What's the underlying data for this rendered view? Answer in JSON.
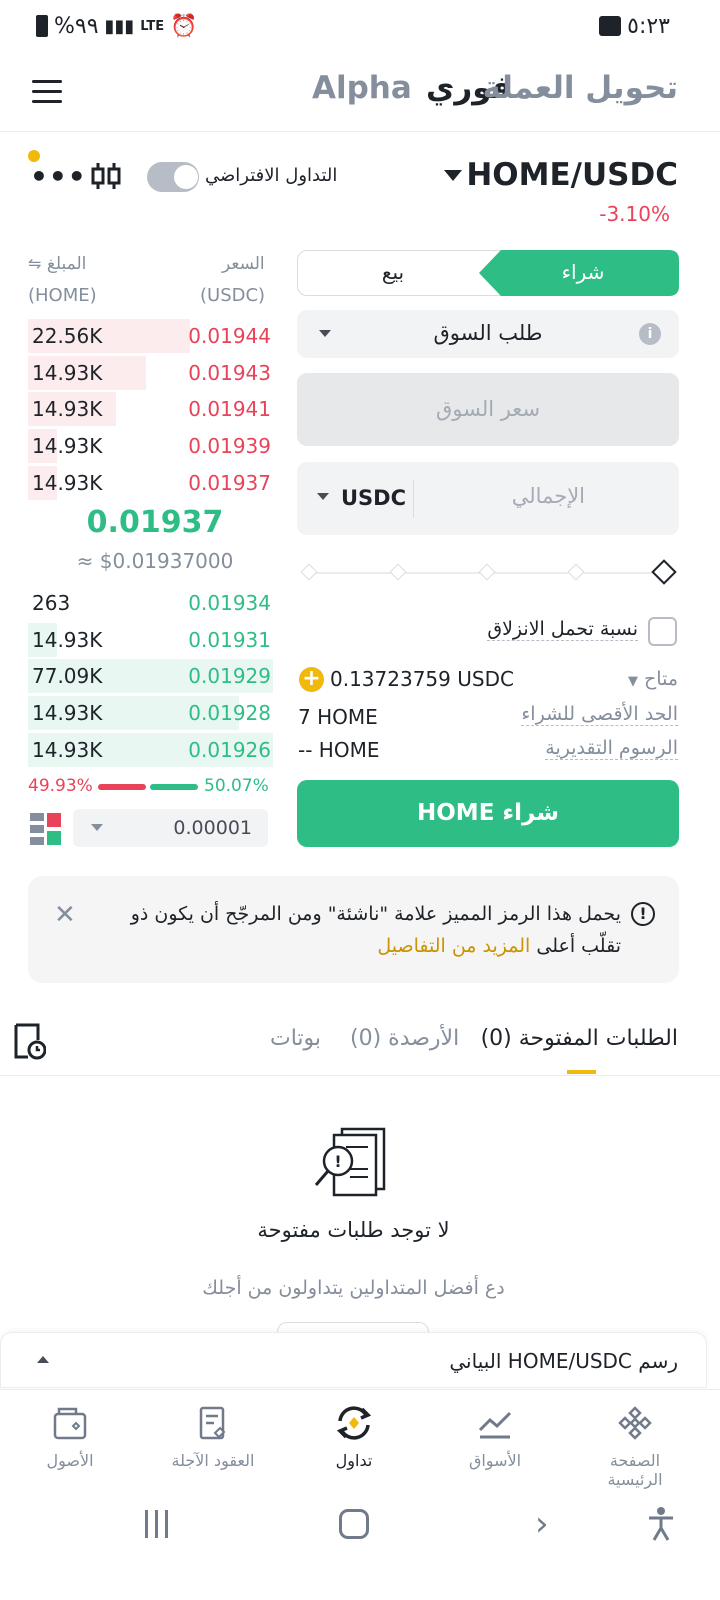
{
  "status": {
    "time": "٥:٢٣",
    "battery": "%٩٩",
    "network": "LTE"
  },
  "header": {
    "tabs": [
      "تحويل العملة",
      "فوري",
      "Alpha"
    ]
  },
  "pair": {
    "name": "HOME/USDC",
    "change": "-3.10%",
    "demo_label": "التداول الافتراضي"
  },
  "orderbook": {
    "price_header": "السعر",
    "price_unit": "(USDC)",
    "amount_header": "المبلغ",
    "amount_unit": "(HOME)",
    "asks": [
      {
        "amount": "22.56K",
        "price": "0.01944",
        "depth": 0.66
      },
      {
        "amount": "14.93K",
        "price": "0.01943",
        "depth": 0.48
      },
      {
        "amount": "14.93K",
        "price": "0.01941",
        "depth": 0.36
      },
      {
        "amount": "14.93K",
        "price": "0.01939",
        "depth": 0.12
      },
      {
        "amount": "14.93K",
        "price": "0.01937",
        "depth": 0.12
      }
    ],
    "last_price": "0.01937",
    "last_price_fiat": "≈ $0.01937000",
    "bids": [
      {
        "amount": "263",
        "price": "0.01934",
        "depth": 0.0
      },
      {
        "amount": "14.93K",
        "price": "0.01931",
        "depth": 0.12
      },
      {
        "amount": "77.09K",
        "price": "0.01929",
        "depth": 1.0
      },
      {
        "amount": "14.93K",
        "price": "0.01928",
        "depth": 0.86
      },
      {
        "amount": "14.93K",
        "price": "0.01926",
        "depth": 1.0
      }
    ],
    "sell_ratio": "49.93%",
    "buy_ratio": "50.07%",
    "sell_fraction": 0.4993,
    "precision": "0.00001"
  },
  "trade": {
    "buy_tab": "شراء",
    "sell_tab": "بيع",
    "order_type": "طلب السوق",
    "market_price_placeholder": "سعر السوق",
    "total_placeholder": "الإجمالي",
    "total_currency": "USDC",
    "slippage_label": "نسبة تحمل الانزلاق",
    "available_label": "متاح",
    "available_value": "0.13723759 USDC",
    "max_buy_label": "الحد الأقصى للشراء",
    "max_buy_value": "7 HOME",
    "fees_label": "الرسوم التقديرية",
    "fees_value": "-- HOME",
    "buy_button": "شراء HOME"
  },
  "notice": {
    "text": "يحمل هذا الرمز المميز علامة \"ناشئة\" ومن المرجّح أن يكون ذو تقلّب أعلى",
    "link": "المزيد من التفاصيل"
  },
  "orders": {
    "tabs": [
      "الطلبات المفتوحة (0)",
      "الأرصدة (0)",
      "بوتات"
    ],
    "empty_title": "لا توجد طلبات مفتوحة",
    "empty_subtitle": "دع أفضل المتداولين يتداولون من أجلك"
  },
  "chart_bar": {
    "label": "رسم HOME/USDC البياني"
  },
  "bottom_nav": [
    {
      "label": "الصفحة الرئيسية",
      "icon": "home-diamond-icon"
    },
    {
      "label": "الأسواق",
      "icon": "markets-icon"
    },
    {
      "label": "تداول",
      "icon": "trade-icon"
    },
    {
      "label": "العقود الآجلة",
      "icon": "futures-icon"
    },
    {
      "label": "الأصول",
      "icon": "wallet-icon"
    }
  ],
  "colors": {
    "green": "#2ebd85",
    "red": "#e94359",
    "yellow": "#f0b90b"
  }
}
